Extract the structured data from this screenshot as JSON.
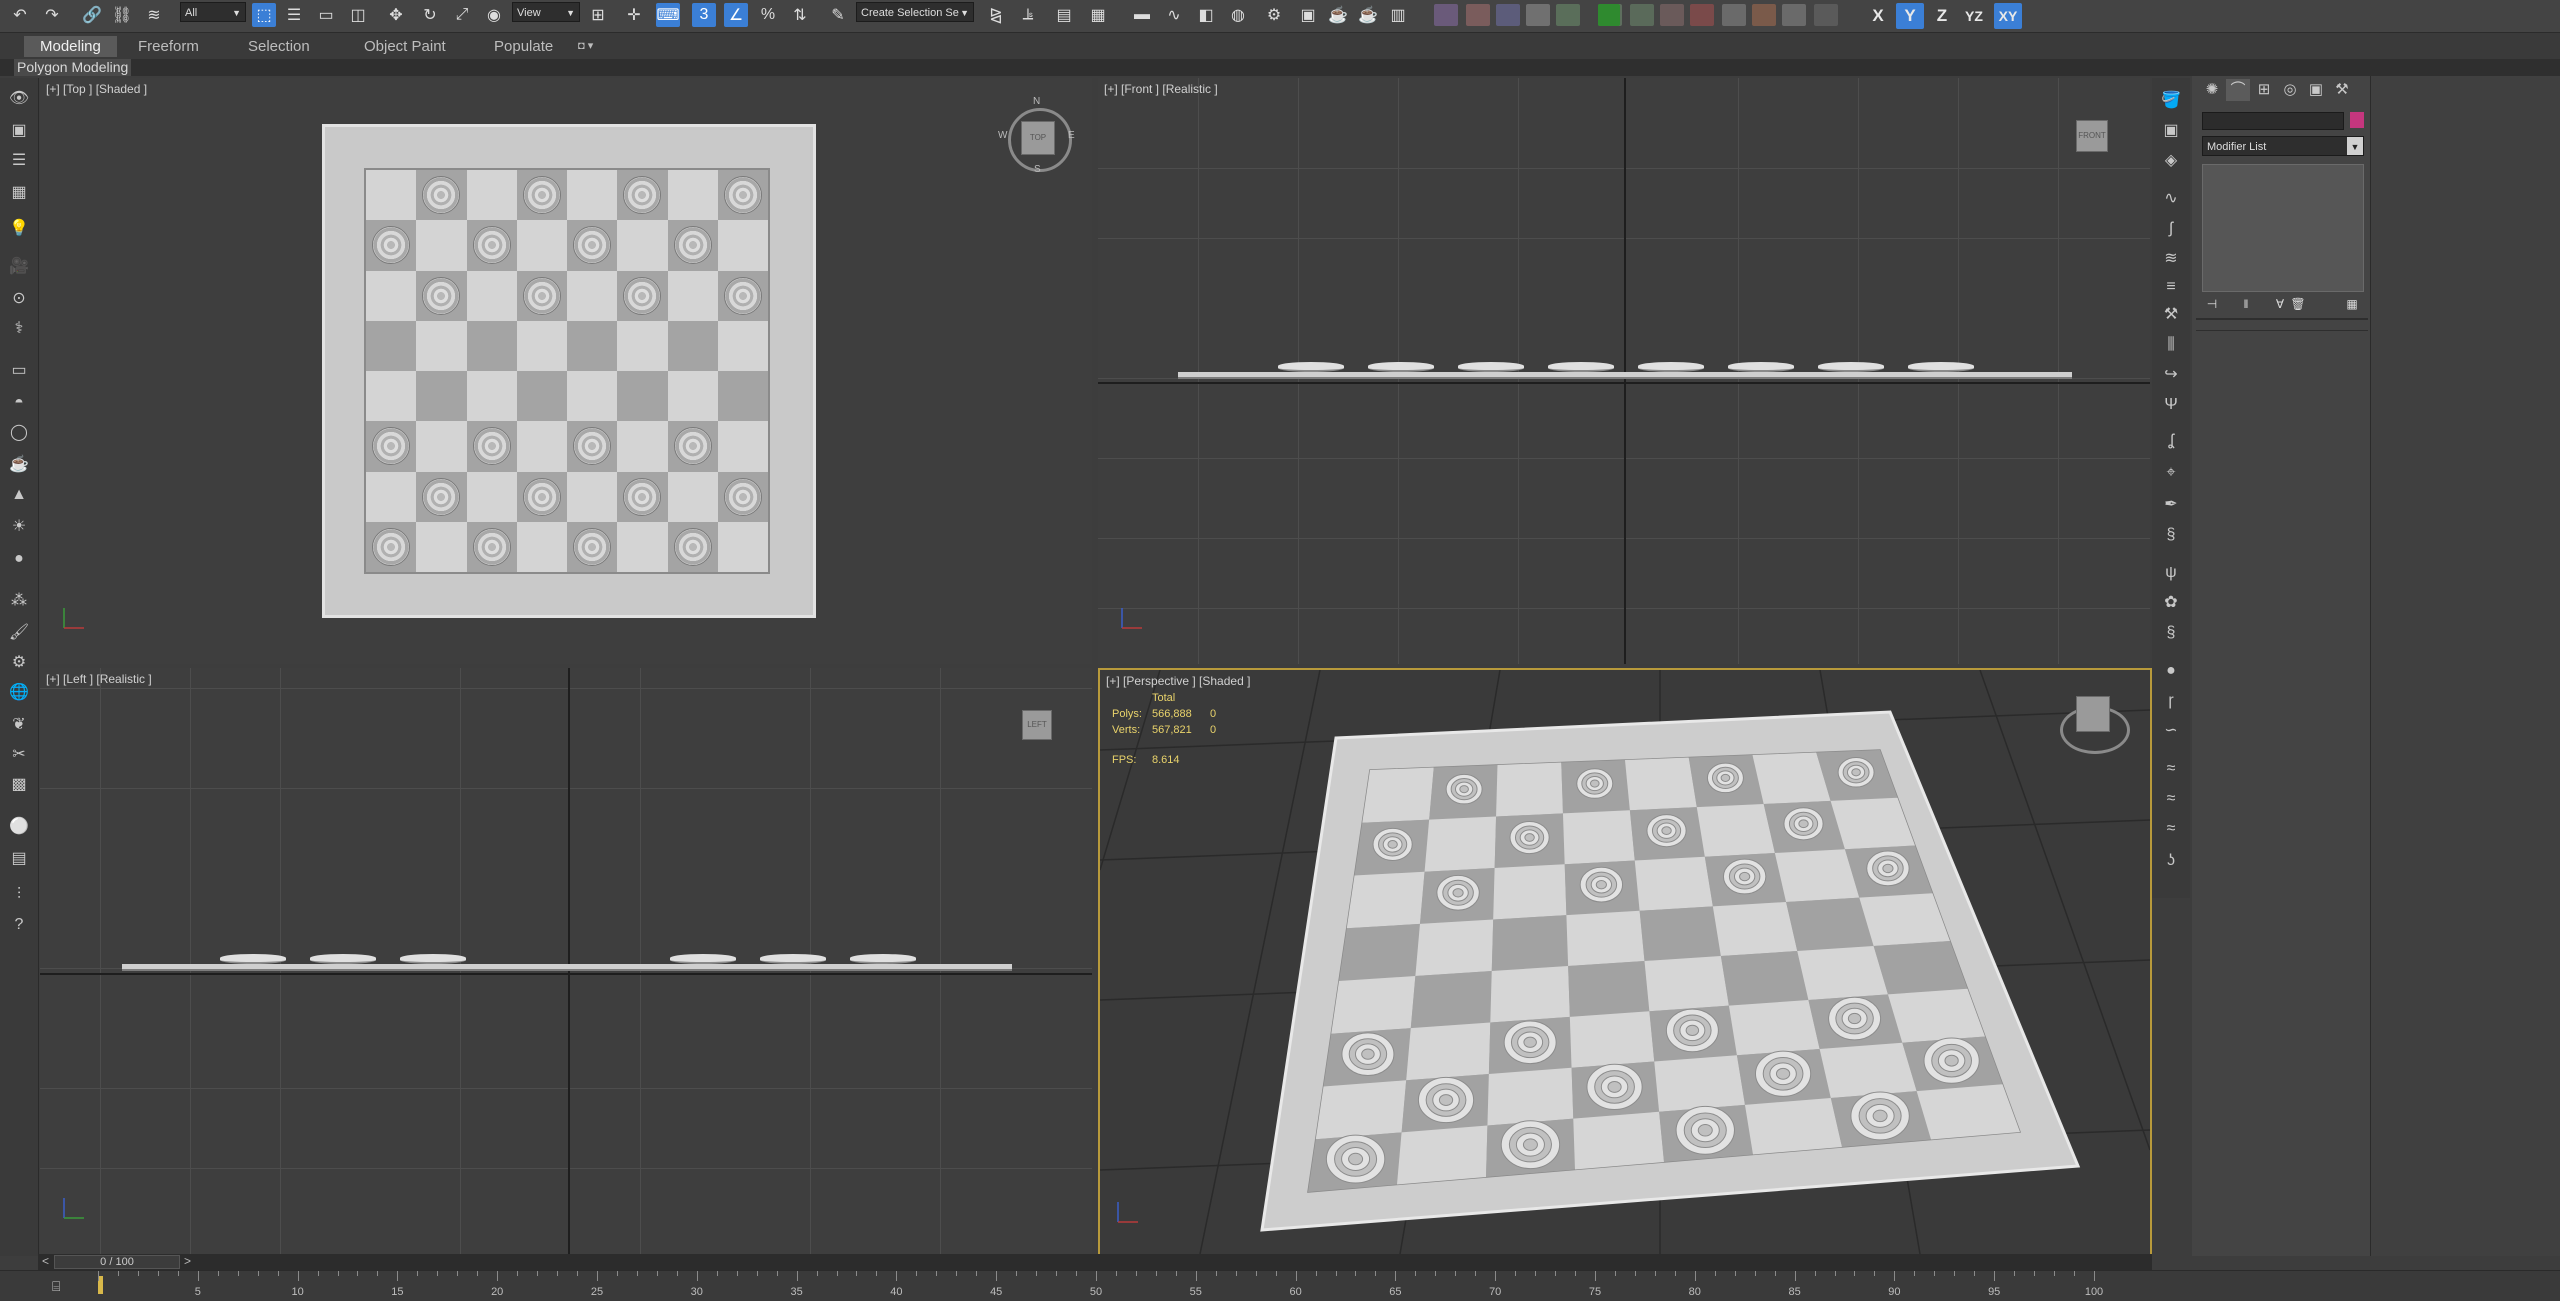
{
  "toolbar": {
    "selection_filter": "All",
    "coord_system": "View",
    "snap_label": "3",
    "named_selection_placeholder": "Create Selection Se",
    "axes": [
      "X",
      "Y",
      "Z",
      "YZ",
      "XY"
    ],
    "active_axes": [
      "Y",
      "XY"
    ]
  },
  "ribbon": {
    "tabs": [
      "Modeling",
      "Freeform",
      "Selection",
      "Object Paint",
      "Populate"
    ],
    "active_tab": "Modeling",
    "sub_label": "Polygon Modeling"
  },
  "viewports": {
    "top_label": "[+] [Top ] [Shaded ]",
    "front_label": "[+] [Front ] [Realistic ]",
    "left_label": "[+] [Left ] [Realistic ]",
    "persp_label": "[+] [Perspective ] [Shaded ]",
    "cube_top": "TOP",
    "cube_front": "FRONT",
    "cube_left": "LEFT",
    "compass": {
      "n": "N",
      "s": "S",
      "e": "E",
      "w": "W"
    }
  },
  "stats": {
    "header": "Total",
    "polys_label": "Polys:",
    "polys_total": "566,888",
    "polys_sel": "0",
    "verts_label": "Verts:",
    "verts_total": "567,821",
    "verts_sel": "0",
    "fps_label": "FPS:",
    "fps_value": "8.614"
  },
  "board": {
    "rows": [
      [
        0,
        1,
        0,
        1,
        0,
        1,
        0,
        1
      ],
      [
        1,
        0,
        1,
        0,
        1,
        0,
        1,
        0
      ],
      [
        0,
        1,
        0,
        1,
        0,
        1,
        0,
        1
      ],
      [
        0,
        0,
        0,
        0,
        0,
        0,
        0,
        0
      ],
      [
        0,
        0,
        0,
        0,
        0,
        0,
        0,
        0
      ],
      [
        1,
        0,
        1,
        0,
        1,
        0,
        1,
        0
      ],
      [
        0,
        1,
        0,
        1,
        0,
        1,
        0,
        1
      ],
      [
        1,
        0,
        1,
        0,
        1,
        0,
        1,
        0
      ]
    ]
  },
  "command_panel": {
    "modifier_list": "Modifier List",
    "accent_color": "#c5367e"
  },
  "timeline": {
    "frame_display": "0 / 100",
    "prev_label": "<",
    "next_label": ">",
    "ticks": [
      "5",
      "10",
      "15",
      "20",
      "25",
      "30",
      "35",
      "40",
      "45",
      "50",
      "55",
      "60",
      "65",
      "70",
      "75",
      "80",
      "85",
      "90",
      "95",
      "100"
    ]
  },
  "colors": {
    "active_blue": "#3b7fd6",
    "viewport_active_border": "#b89a3b",
    "stats_text": "#e9d36b"
  }
}
